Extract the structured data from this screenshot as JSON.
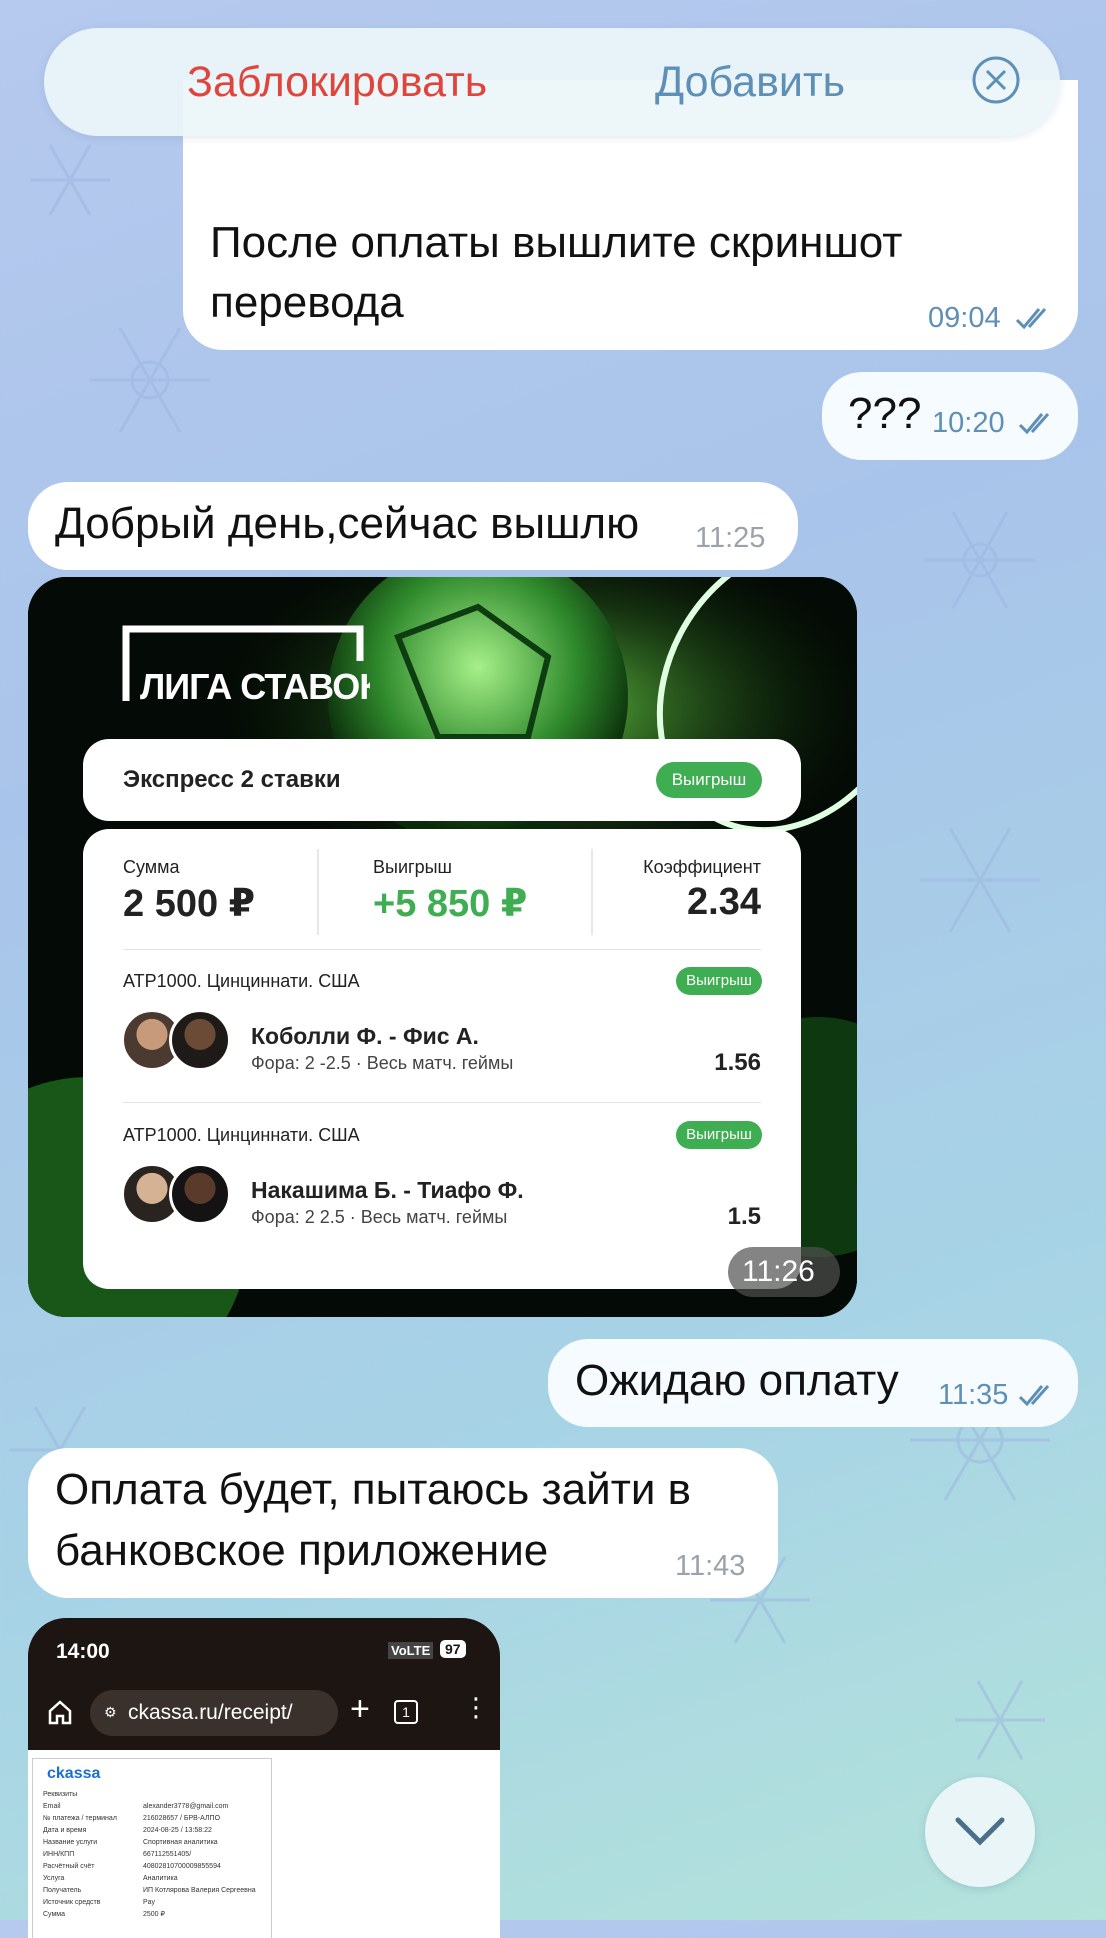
{
  "topbar": {
    "block_label": "Заблокировать",
    "add_label": "Добавить"
  },
  "messages": {
    "m1": {
      "text_line1": "После оплаты вышлите скриншот",
      "text_line2": "перевода",
      "time": "09:04"
    },
    "m2": {
      "text": "???",
      "time": "10:20"
    },
    "m3": {
      "text": "Добрый день,сейчас вышлю",
      "time": "11:25"
    },
    "m4": {
      "time": "11:26"
    },
    "m5": {
      "text": "Ожидаю оплату",
      "time": "11:35"
    },
    "m6": {
      "text_line1": "Оплата будет, пытаюсь зайти в",
      "text_line2": "банковское приложение",
      "time": "11:43"
    }
  },
  "bet": {
    "logo": "ЛИГА СТАВОК",
    "title": "Экспресс 2 ставки",
    "status": "Выигрыш",
    "sum_label": "Сумма",
    "sum_value": "2 500 ₽",
    "win_label": "Выигрыш",
    "win_value": "+5 850 ₽",
    "coef_label": "Коэффициент",
    "coef_value": "2.34",
    "events": [
      {
        "tournament": "ATP1000. Цинциннати. США",
        "status": "Выигрыш",
        "players": "Коболли Ф. - Фис А.",
        "market": "Фора: 2 -2.5 · Весь матч. геймы",
        "odds": "1.56"
      },
      {
        "tournament": "ATP1000. Цинциннати. США",
        "status": "Выигрыш",
        "players": "Накашима Б. - Тиафо Ф.",
        "market": "Фора: 2 2.5 · Весь матч. геймы",
        "odds": "1.5"
      }
    ]
  },
  "preview": {
    "clock": "14:00",
    "battery": "97",
    "network": "VoLTE",
    "url": "ckassa.ru/receipt/",
    "tabs_count": "1",
    "brand": "ckassa",
    "receipt_lines": [
      [
        "Реквизиты",
        ""
      ],
      [
        "Email",
        "alexander3778@gmail.com"
      ],
      [
        "№ платежа / терминал",
        "216028657 / БРВ-АЛПО"
      ],
      [
        "Дата и время",
        "2024-08-25 / 13:58:22"
      ],
      [
        "Название услуги",
        "Спортивная аналитика"
      ],
      [
        "ИНН/КПП",
        "667112551405/"
      ],
      [
        "Расчётный счёт",
        "40802810700009855594"
      ],
      [
        "Услуга",
        "Аналитика"
      ],
      [
        "Получатель",
        "ИП Котлярова Валерия Сергеевна"
      ],
      [
        "Источник средств",
        "Pay"
      ],
      [
        "Сумма",
        "2500 ₽"
      ]
    ]
  },
  "colors": {
    "accent_blue": "#5e8fb6",
    "block_red": "#e0453d",
    "win_green": "#3fae52"
  }
}
